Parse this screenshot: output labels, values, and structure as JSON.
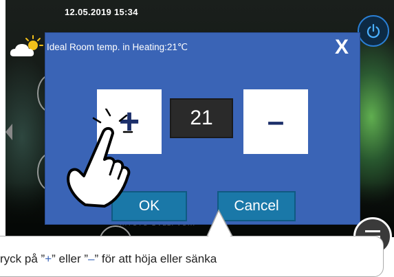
{
  "status_bar": {
    "datetime": "12.05.2019  15:34"
  },
  "dialog": {
    "title": "Ideal Room temp. in Heating:21℃",
    "close_label": "X",
    "plus_label": "+",
    "value": "21",
    "minus_label": "–",
    "ok_label": "OK",
    "cancel_label": "Cancel"
  },
  "background": {
    "hint_text": "...TUTU OVLLI VU..."
  },
  "callout": {
    "text_start": "ryck på ”",
    "plus_symbol": "+",
    "text_middle": "” eller ”",
    "minus_symbol": "–",
    "text_end": "” för att höja eller sänka"
  },
  "icons": [
    "power-icon",
    "weather-partly-sunny-icon",
    "menu-icon",
    "hand-pointer-icon"
  ],
  "colors": {
    "dialog_bg": "#3a64b6",
    "button_blue": "#1a78a8",
    "power_ring": "#2a7fd4"
  }
}
